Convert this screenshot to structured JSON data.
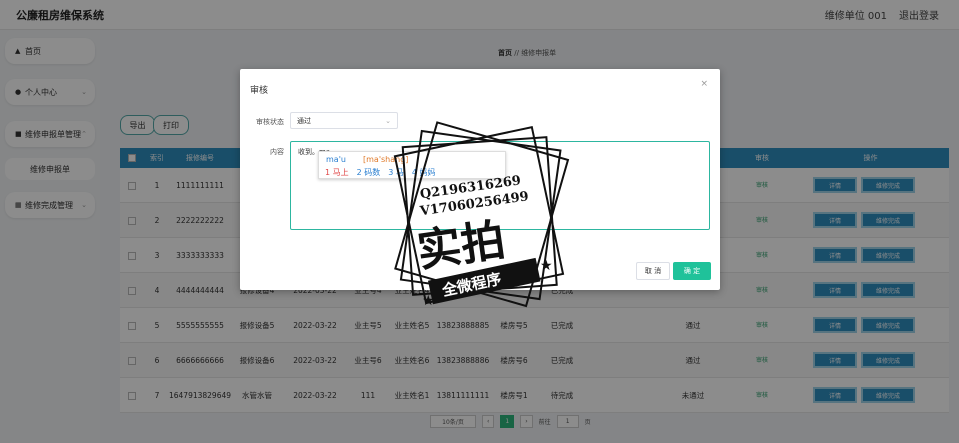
{
  "header": {
    "app_title": "公廉租房维保系统",
    "unit": "维修单位 001",
    "logout": "退出登录"
  },
  "sidebar": {
    "items": [
      {
        "label": "首页",
        "icon": "home-icon"
      },
      {
        "label": "个人中心",
        "icon": "user-icon"
      },
      {
        "label": "维修申报单管理",
        "icon": "chat-icon"
      },
      {
        "label": "维修申报单",
        "icon": ""
      },
      {
        "label": "维修完成管理",
        "icon": "grid-icon"
      }
    ]
  },
  "breadcrumb": {
    "home": "首页",
    "sep": "//",
    "current": "维修申报单"
  },
  "toolbar": {
    "export": "导出",
    "print": "打印"
  },
  "table": {
    "headers": {
      "index": "索引",
      "report_no": "报修编号",
      "audit": "审核",
      "ops": "操作"
    },
    "rows": [
      {
        "index": "1",
        "report_no": "1111111111",
        "device": "",
        "date": "",
        "owner": "",
        "owner_name": "",
        "phone": "",
        "building": "",
        "status": "",
        "audit_state": ""
      },
      {
        "index": "2",
        "report_no": "2222222222",
        "device": "",
        "date": "",
        "owner": "",
        "owner_name": "",
        "phone": "",
        "building": "",
        "status": "",
        "audit_state": ""
      },
      {
        "index": "3",
        "report_no": "3333333333",
        "device": "",
        "date": "",
        "owner": "",
        "owner_name": "",
        "phone": "",
        "building": "",
        "status": "",
        "audit_state": ""
      },
      {
        "index": "4",
        "report_no": "4444444444",
        "device": "报修设备4",
        "date": "2022-03-22",
        "owner": "业主号4",
        "owner_name": "业主姓名4",
        "phone": "",
        "building": "",
        "status": "已完成",
        "audit_state": ""
      },
      {
        "index": "5",
        "report_no": "5555555555",
        "device": "报修设备5",
        "date": "2022-03-22",
        "owner": "业主号5",
        "owner_name": "业主姓名5",
        "phone": "13823888885",
        "building": "楼房号5",
        "status": "已完成",
        "audit_state": "通过"
      },
      {
        "index": "6",
        "report_no": "6666666666",
        "device": "报修设备6",
        "date": "2022-03-22",
        "owner": "业主号6",
        "owner_name": "业主姓名6",
        "phone": "13823888886",
        "building": "楼房号6",
        "status": "已完成",
        "audit_state": "通过"
      },
      {
        "index": "7",
        "report_no": "1647913829649",
        "device": "水管水管",
        "date": "2022-03-22",
        "owner": "111",
        "owner_name": "业主姓名1",
        "phone": "13811111111",
        "building": "楼房号1",
        "status": "待完成",
        "audit_state": "未通过"
      }
    ],
    "audit_link": "审核",
    "detail_btn": "详情",
    "finish_btn": "维修完成"
  },
  "pager": {
    "size": "10条/页",
    "current": "1",
    "goto_label": "前往",
    "goto_value": "1",
    "page_suffix": "页"
  },
  "dialog": {
    "title": "审核",
    "status_label": "审核状态",
    "status_value": "通过",
    "content_label": "内容",
    "content_value": "收到。ma",
    "ime": {
      "pinyin": "ma'u",
      "hint": "[ma'shang]",
      "candidates": [
        "1 马上",
        "2 码数",
        "3 马",
        "4 妈妈"
      ]
    },
    "cancel": "取 消",
    "ok": "确 定"
  },
  "watermark": {
    "line1": "Q2196316269",
    "line2": "V17060256499",
    "big": "实拍",
    "banner": "全微程序"
  }
}
